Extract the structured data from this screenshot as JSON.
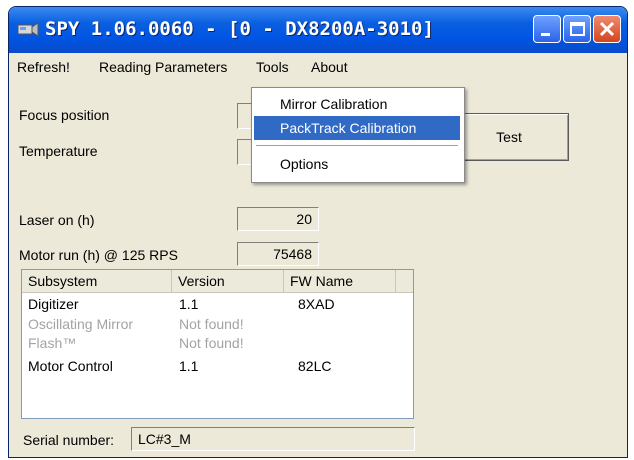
{
  "window": {
    "title": "SPY 1.06.0060 - [0 - DX8200A-3010]"
  },
  "menubar": {
    "items": [
      {
        "label": "Refresh!"
      },
      {
        "label": "Reading Parameters"
      },
      {
        "label": "Tools"
      },
      {
        "label": "About"
      }
    ]
  },
  "tools_menu": {
    "items": [
      {
        "label": "Mirror Calibration"
      },
      {
        "label": "PackTrack Calibration",
        "selected": true
      },
      {
        "label": "Options"
      }
    ]
  },
  "fields": {
    "focus_position": {
      "label": "Focus position",
      "value": ""
    },
    "temperature": {
      "label": "Temperature",
      "value": ""
    },
    "laser_on": {
      "label": "Laser on (h)",
      "value": "20"
    },
    "motor_run": {
      "label": "Motor run (h) @ 125 RPS",
      "value": "75468"
    }
  },
  "test_button": {
    "label": "Test"
  },
  "subsystems": {
    "columns": [
      "Subsystem",
      "Version",
      "FW Name"
    ],
    "rows": [
      {
        "name": "Digitizer",
        "version": "1.1",
        "fw": "8XAD",
        "found": true
      },
      {
        "name": "Oscillating Mirror",
        "version": "Not found!",
        "fw": "",
        "found": false
      },
      {
        "name": "Flash™",
        "version": "Not found!",
        "fw": "",
        "found": false
      },
      {
        "name": "Motor Control",
        "version": "1.1",
        "fw": "82LC",
        "found": true
      }
    ]
  },
  "serial": {
    "label": "Serial number:",
    "value": "LC#3_M"
  }
}
